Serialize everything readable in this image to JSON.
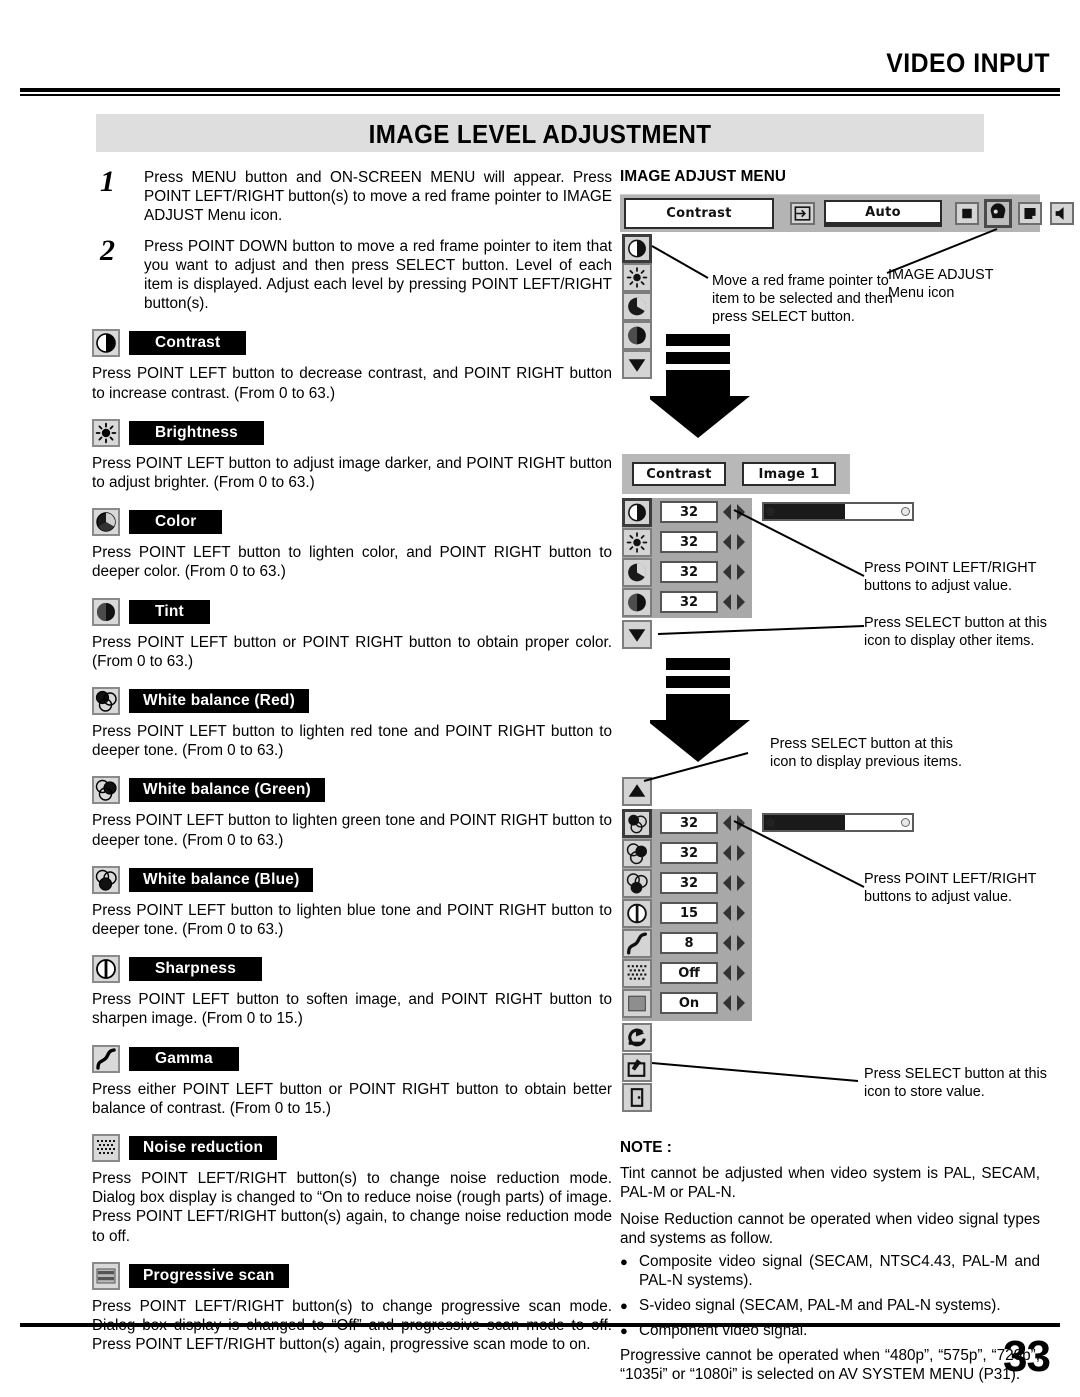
{
  "header": {
    "category": "VIDEO INPUT",
    "section_title": "IMAGE LEVEL ADJUSTMENT"
  },
  "steps": [
    {
      "num": "1",
      "text": "Press MENU button and ON-SCREEN MENU will appear.  Press POINT LEFT/RIGHT button(s) to move a red frame pointer to IMAGE ADJUST Menu icon."
    },
    {
      "num": "2",
      "text": "Press POINT DOWN button to move a red frame pointer to item that you want to adjust and then press SELECT button.  Level of each item is displayed.  Adjust each level by pressing POINT LEFT/RIGHT button(s)."
    }
  ],
  "items": [
    {
      "icon": "contrast-icon",
      "label": "Contrast",
      "text": "Press POINT LEFT button to decrease contrast, and POINT RIGHT button to increase contrast.  (From 0 to 63.)"
    },
    {
      "icon": "brightness-icon",
      "label": "Brightness",
      "text": "Press POINT LEFT button to adjust image darker, and POINT RIGHT button to adjust brighter.  (From 0 to 63.)"
    },
    {
      "icon": "color-icon",
      "label": "Color",
      "text": "Press POINT LEFT button to lighten color, and POINT RIGHT button to deeper color.  (From 0 to 63.)"
    },
    {
      "icon": "tint-icon",
      "label": "Tint",
      "text": "Press POINT LEFT button or POINT RIGHT button to obtain proper color.  (From 0 to 63.)"
    },
    {
      "icon": "white-balance-red-icon",
      "label": "White balance (Red)",
      "text": "Press POINT LEFT button to lighten red tone and POINT RIGHT button to deeper tone.  (From 0 to 63.)"
    },
    {
      "icon": "white-balance-green-icon",
      "label": "White balance (Green)",
      "text": "Press POINT LEFT button to lighten green tone and POINT RIGHT button to deeper tone.  (From 0 to 63.)"
    },
    {
      "icon": "white-balance-blue-icon",
      "label": "White balance (Blue)",
      "text": "Press POINT LEFT button to lighten blue tone and POINT RIGHT button to deeper tone.  (From 0 to 63.)"
    },
    {
      "icon": "sharpness-icon",
      "label": "Sharpness",
      "text": "Press POINT LEFT button to soften image, and POINT RIGHT button to sharpen image.  (From 0 to 15.)"
    },
    {
      "icon": "gamma-icon",
      "label": "Gamma",
      "text": "Press either POINT LEFT button or POINT RIGHT button to obtain better balance of contrast.  (From 0 to 15.)"
    },
    {
      "icon": "noise-reduction-icon",
      "label": "Noise reduction",
      "text": "Press POINT LEFT/RIGHT button(s) to change noise reduction mode. Dialog box display is changed to “On to reduce noise (rough parts) of image. Press POINT LEFT/RIGHT button(s) again, to change noise reduction mode to off."
    },
    {
      "icon": "progressive-scan-icon",
      "label": "Progressive scan",
      "text": "Press POINT LEFT/RIGHT button(s) to change progressive scan mode.  Dialog box display is changed to “Off” and progressive scan mode to off. Press POINT LEFT/RIGHT button(s) again, progressive scan mode to on."
    }
  ],
  "osd": {
    "title": "IMAGE ADJUST MENU",
    "menu_bar": {
      "current_item": "Contrast",
      "auto_label": "Auto",
      "icons": [
        "input-source-icon",
        "screen-icon",
        "image-adjust-icon",
        "image-select-icon",
        "sound-icon"
      ]
    },
    "panel1": {
      "side_icons": [
        "contrast-icon",
        "brightness-icon",
        "color-icon",
        "tint-icon",
        "scroll-down-icon"
      ],
      "annotation": "Move a red frame pointer to item to be selected and then press SELECT button.",
      "menu_icon_annotation": "IMAGE ADJUST\nMenu icon"
    },
    "panel2": {
      "title_left": "Contrast",
      "title_right": "Image 1",
      "rows": [
        {
          "icon": "contrast-icon",
          "value": "32"
        },
        {
          "icon": "brightness-icon",
          "value": "32"
        },
        {
          "icon": "color-icon",
          "value": "32"
        },
        {
          "icon": "tint-icon",
          "value": "32"
        }
      ],
      "scroll_icon": "scroll-down-icon",
      "slider_percent": 55,
      "annotation_adjust": "Press POINT LEFT/RIGHT buttons to adjust value.",
      "annotation_other": "Press SELECT button at this icon to display other items."
    },
    "panel3": {
      "scroll_up_icon": "scroll-up-icon",
      "rows": [
        {
          "icon": "white-balance-red-icon",
          "value": "32"
        },
        {
          "icon": "white-balance-green-icon",
          "value": "32"
        },
        {
          "icon": "white-balance-blue-icon",
          "value": "32"
        },
        {
          "icon": "sharpness-icon",
          "value": "15"
        },
        {
          "icon": "gamma-icon",
          "value": "8"
        },
        {
          "icon": "noise-reduction-icon",
          "value": "Off"
        },
        {
          "icon": "progressive-scan-icon",
          "value": "On"
        }
      ],
      "bottom_icons": [
        "reset-icon",
        "store-icon",
        "quit-icon"
      ],
      "slider_percent": 55,
      "annotation_previous": "Press SELECT button at this icon to display previous items.",
      "annotation_adjust": "Press POINT LEFT/RIGHT buttons to adjust value.",
      "annotation_store": "Press SELECT button at this icon to store value."
    }
  },
  "note": {
    "title": "NOTE :",
    "paragraphs": [
      "Tint cannot be adjusted when video system is PAL, SECAM, PAL-M or PAL-N.",
      "Noise Reduction cannot be operated when video signal types and systems as follow."
    ],
    "bullets": [
      "Composite video signal (SECAM, NTSC4.43, PAL-M and PAL-N systems).",
      "S-video signal (SECAM, PAL-M and PAL-N systems).",
      "Component video signal."
    ],
    "closing": "Progressive cannot be operated when “480p”, “575p”, “720p”, “1035i” or “1080i” is selected on AV SYSTEM MENU (P31)."
  },
  "footer": {
    "page_number": "33"
  }
}
